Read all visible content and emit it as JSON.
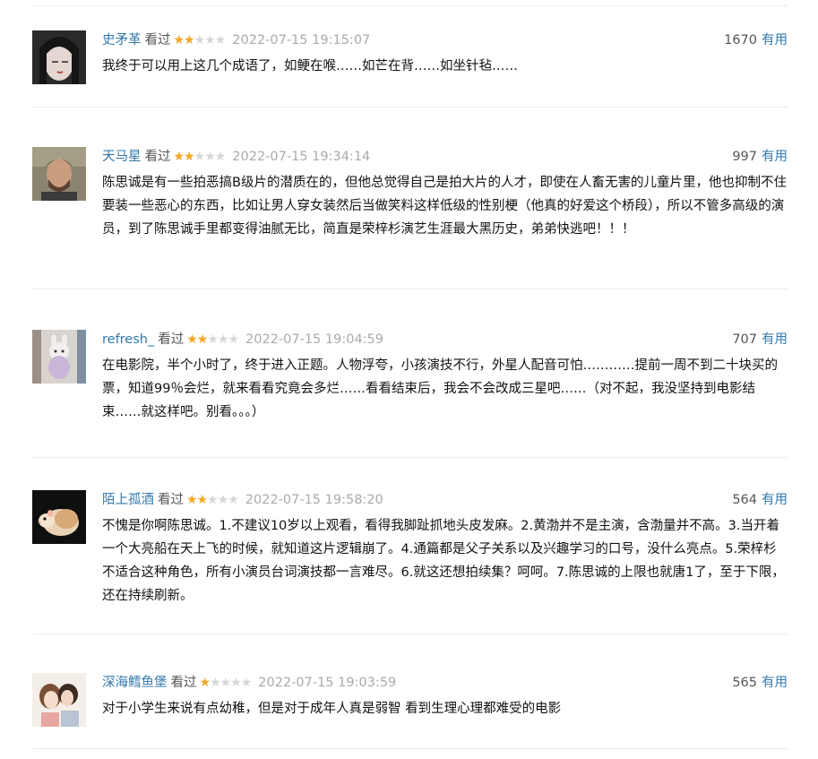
{
  "reviews": [
    {
      "user": "史矛革",
      "status": "看过",
      "rating": 2,
      "max_rating": 5,
      "time": "2022-07-15 19:15:07",
      "votes": "1670",
      "useful_label": "有用",
      "text": "我终于可以用上这几个成语了，如鲠在喉……如芒在背……如坐针毡……",
      "avatar_icon": "woman-portrait-avatar"
    },
    {
      "user": "天马星",
      "status": "看过",
      "rating": 2,
      "max_rating": 5,
      "time": "2022-07-15 19:34:14",
      "votes": "997",
      "useful_label": "有用",
      "text": "陈思诚是有一些拍恶搞B级片的潜质在的，但他总觉得自己是拍大片的人才，即使在人畜无害的儿童片里，他也抑制不住要装一些恶心的东西，比如让男人穿女装然后当做笑料这样低级的性别梗（他真的好爱这个桥段），所以不管多高级的演员，到了陈思诚手里都变得油腻无比，简直是荣梓杉演艺生涯最大黑历史，弟弟快逃吧！！！",
      "avatar_icon": "man-portrait-avatar"
    },
    {
      "user": "refresh_",
      "status": "看过",
      "rating": 2,
      "max_rating": 5,
      "time": "2022-07-15 19:04:59",
      "votes": "707",
      "useful_label": "有用",
      "text": "在电影院，半个小时了，终于进入正题。人物浮夸，小孩演技不行，外星人配音可怕…………提前一周不到二十块买的票，知道99％会烂，就来看看究竟会多烂……看看结束后，我会不会改成三星吧……（对不起，我没坚持到电影结束……就这样吧。别看。。。）",
      "avatar_icon": "plush-toy-avatar"
    },
    {
      "user": "陌上孤酒",
      "status": "看过",
      "rating": 2,
      "max_rating": 5,
      "time": "2022-07-15 19:58:20",
      "votes": "564",
      "useful_label": "有用",
      "text": "不愧是你啊陈思诚。1.不建议10岁以上观看，看得我脚趾抓地头皮发麻。2.黄渤并不是主演，含渤量并不高。3.当开着一个大亮船在天上飞的时候，就知道这片逻辑崩了。4.通篇都是父子关系以及兴趣学习的口号，没什么亮点。5.荣梓杉不适合这种角色，所有小演员台词演技都一言难尽。6.就这还想拍续集？呵呵。7.陈思诚的上限也就唐1了，至于下限，还在持续刷新。",
      "avatar_icon": "hamster-avatar"
    },
    {
      "user": "深海鳕鱼堡",
      "status": "看过",
      "rating": 1,
      "max_rating": 5,
      "time": "2022-07-15 19:03:59",
      "votes": "565",
      "useful_label": "有用",
      "text": "对于小学生来说有点幼稚，但是对于成年人真是弱智 看到生理心理都难受的电影",
      "avatar_icon": "couple-illustration-avatar"
    }
  ]
}
